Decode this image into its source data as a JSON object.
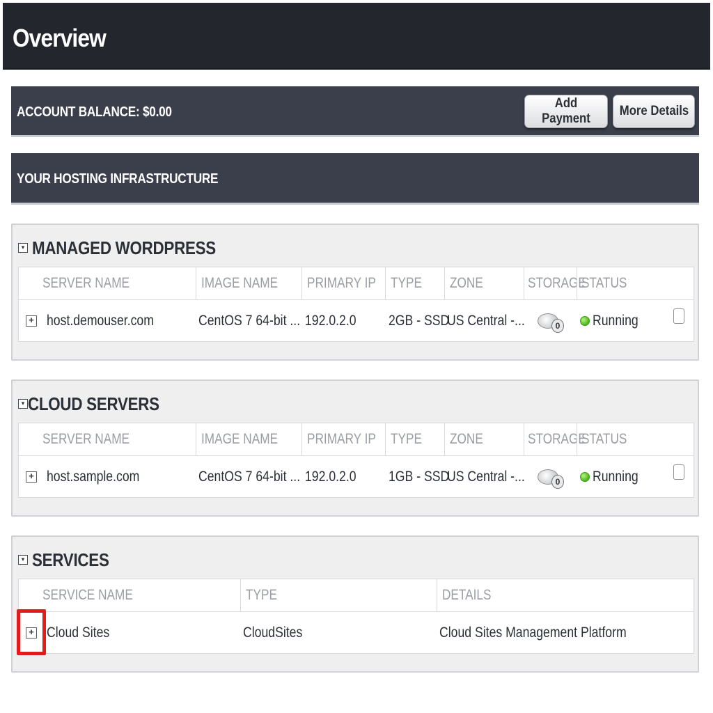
{
  "header": {
    "title": "Overview"
  },
  "account": {
    "balance_label": "ACCOUNT BALANCE: $0.00",
    "add_payment_label": "Add Payment",
    "more_details_label": "More Details"
  },
  "infrastructure": {
    "title": "YOUR HOSTING INFRASTRUCTURE"
  },
  "server_columns": [
    "SERVER NAME",
    "IMAGE NAME",
    "PRIMARY IP",
    "TYPE",
    "ZONE",
    "STORAGE",
    "STATUS"
  ],
  "managed_wordpress": {
    "title": "MANAGED WORDPRESS",
    "rows": [
      {
        "server_name": "host.demouser.com",
        "image_name": "CentOS 7 64-bit ...",
        "primary_ip": "192.0.2.0",
        "type": "2GB - SSD",
        "zone": "US Central -...",
        "storage_count": "0",
        "status": "Running"
      }
    ]
  },
  "cloud_servers": {
    "title": "CLOUD SERVERS",
    "rows": [
      {
        "server_name": "host.sample.com",
        "image_name": "CentOS 7 64-bit ...",
        "primary_ip": "192.0.2.0",
        "type": "1GB - SSD",
        "zone": "US Central -...",
        "storage_count": "0",
        "status": "Running"
      }
    ]
  },
  "services": {
    "title": "SERVICES",
    "columns": [
      "SERVICE NAME",
      "TYPE",
      "DETAILS"
    ],
    "rows": [
      {
        "service_name": "Cloud Sites",
        "type": "CloudSites",
        "details": "Cloud Sites Management Platform"
      }
    ]
  },
  "colors": {
    "header_bg": "#23262d",
    "bar_bg": "#3a3f4b",
    "status_running": "#48b51e",
    "highlight": "#e01c1c"
  },
  "icons": {
    "toggle": "collapse-toggle-icon",
    "expand": "expand-plus-icon",
    "storage": "disk-storage-icon",
    "status": "status-dot-icon"
  }
}
